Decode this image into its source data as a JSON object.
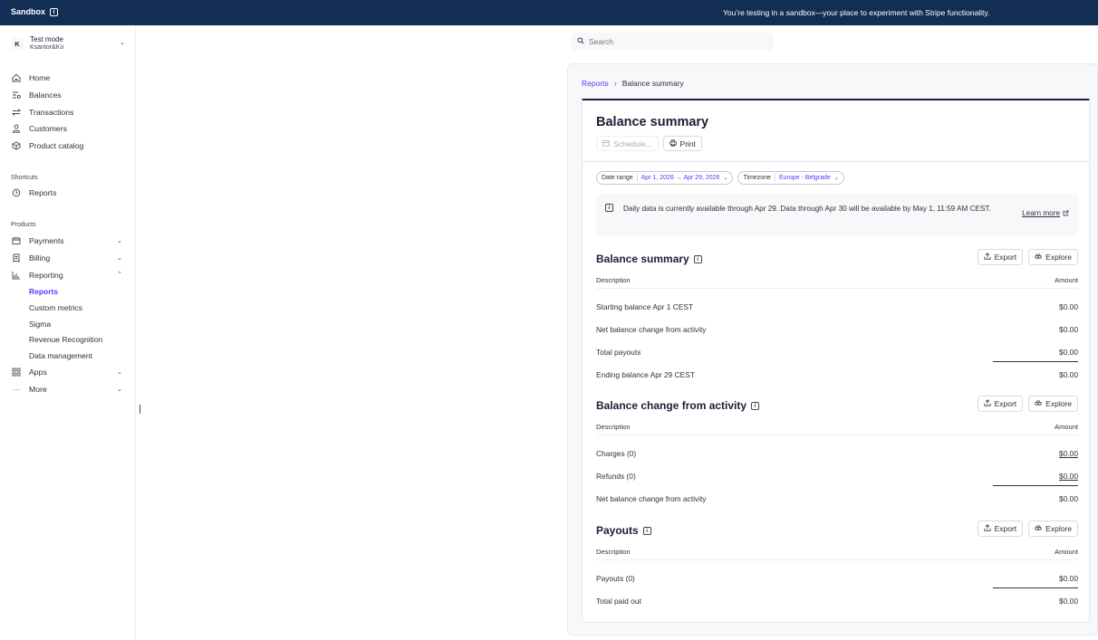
{
  "banner": {
    "brand": "Sandbox",
    "message": "You’re testing in a sandbox—your place to experiment with Stripe functionality."
  },
  "account": {
    "avatar": "K",
    "mode": "Test mode",
    "name": "Ksantor&Ko"
  },
  "sidebar": {
    "main": [
      {
        "label": "Home",
        "icon": "home-icon"
      },
      {
        "label": "Balances",
        "icon": "balances-icon"
      },
      {
        "label": "Transactions",
        "icon": "transactions-icon"
      },
      {
        "label": "Customers",
        "icon": "customers-icon"
      },
      {
        "label": "Product catalog",
        "icon": "product-icon"
      }
    ],
    "shortcuts_label": "Shortcuts",
    "shortcuts": [
      {
        "label": "Reports",
        "icon": "clock-icon"
      }
    ],
    "products_label": "Products",
    "products": {
      "payments": "Payments",
      "billing": "Billing",
      "reporting": "Reporting",
      "reporting_sub": [
        "Reports",
        "Custom metrics",
        "Sigma",
        "Revenue Recognition",
        "Data management"
      ],
      "apps": "Apps",
      "more": "More"
    }
  },
  "search": {
    "placeholder": "Search"
  },
  "breadcrumb": {
    "parent": "Reports",
    "separator": "›",
    "current": "Balance summary"
  },
  "report": {
    "title": "Balance summary",
    "schedule_label": "Schedule...",
    "print_label": "Print",
    "filters": {
      "date_label": "Date range",
      "date_value": "Apr 1, 2026 → Apr 29, 2026",
      "tz_label": "Timezone",
      "tz_value": "Europe - Belgrade"
    },
    "notice": {
      "text": "Daily data is currently available through Apr 29. Data through Apr 30 will be available by May 1, 11:59 AM CEST.",
      "link": "Learn more"
    },
    "export_label": "Export",
    "explore_label": "Explore",
    "col_description": "Description",
    "col_amount": "Amount",
    "sections": [
      {
        "title": "Balance summary",
        "rows": [
          {
            "label": "Starting balance  Apr 1 CEST",
            "amount": "$0.00"
          },
          {
            "label": "Net balance change from activity",
            "amount": "$0.00"
          },
          {
            "label": "Total payouts",
            "amount": "$0.00"
          },
          {
            "label": "Ending balance  Apr 29 CEST",
            "amount": "$0.00"
          }
        ]
      },
      {
        "title": "Balance change from activity",
        "rows": [
          {
            "label": "Charges (0)",
            "amount": "$0.00"
          },
          {
            "label": "Refunds (0)",
            "amount": "$0.00"
          },
          {
            "label": "Net balance change from activity",
            "amount": "$0.00"
          }
        ]
      },
      {
        "title": "Payouts",
        "rows": [
          {
            "label": "Payouts (0)",
            "amount": "$0.00"
          },
          {
            "label": "Total paid out",
            "amount": "$0.00"
          }
        ]
      }
    ]
  }
}
